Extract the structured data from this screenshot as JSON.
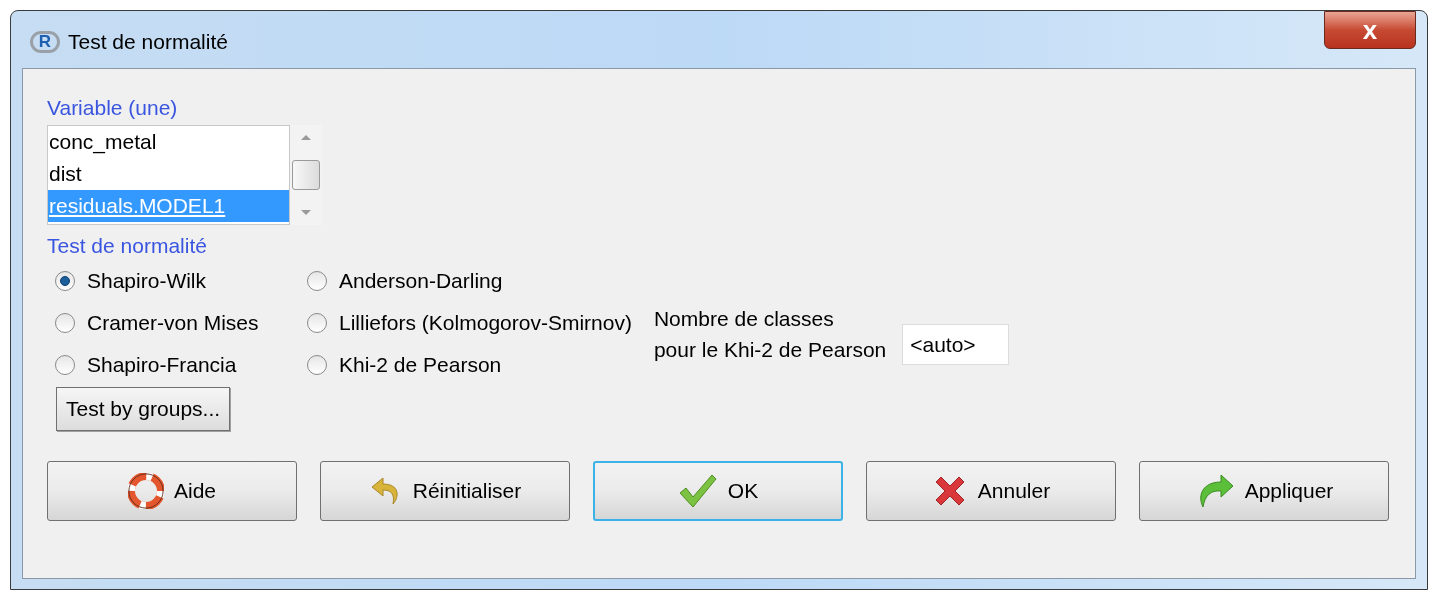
{
  "window": {
    "title": "Test de normalité",
    "icon_text": "R",
    "close_label": "x"
  },
  "variable": {
    "label": "Variable (une)",
    "items": [
      {
        "text": "conc_metal",
        "selected": false
      },
      {
        "text": "dist",
        "selected": false
      },
      {
        "text": "residuals.MODEL1",
        "selected": true
      }
    ]
  },
  "test": {
    "label": "Test de normalité",
    "options": [
      {
        "label": "Shapiro-Wilk",
        "selected": true
      },
      {
        "label": "Anderson-Darling",
        "selected": false
      },
      {
        "label": "Cramer-von Mises",
        "selected": false
      },
      {
        "label": "Lilliefors (Kolmogorov-Smirnov)",
        "selected": false
      },
      {
        "label": "Shapiro-Francia",
        "selected": false
      },
      {
        "label": "Khi-2 de Pearson",
        "selected": false
      }
    ]
  },
  "classes": {
    "label_lines": [
      "Nombre de classes",
      "pour le Khi-2 de Pearson"
    ],
    "value": "<auto>"
  },
  "groups_button": "Test by groups...",
  "buttons": [
    {
      "label": "Aide",
      "kind": "help",
      "default": false
    },
    {
      "label": "Réinitialiser",
      "kind": "reset",
      "default": false
    },
    {
      "label": "OK",
      "kind": "ok",
      "default": true
    },
    {
      "label": "Annuler",
      "kind": "cancel",
      "default": false
    },
    {
      "label": "Appliquer",
      "kind": "apply",
      "default": false
    }
  ]
}
